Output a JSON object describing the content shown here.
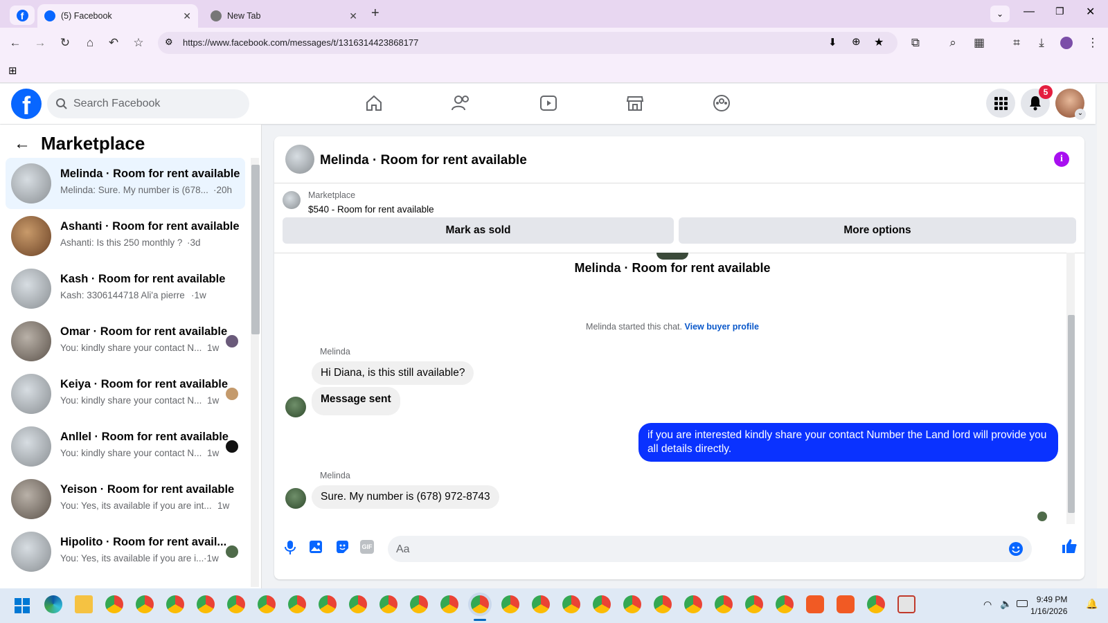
{
  "browser": {
    "tabs": [
      {
        "label": "(5) Facebook",
        "active": true
      },
      {
        "label": "New Tab",
        "active": false
      }
    ],
    "new_tab_symbol": "+",
    "url": "https://www.facebook.com/messages/t/1316314423868177"
  },
  "header": {
    "logo": "f",
    "search_placeholder": "Search Facebook",
    "notification_count": "5"
  },
  "sidebar": {
    "title": "Marketplace",
    "conversations": [
      {
        "name": "Melinda · Room for rent available",
        "preview": "Melinda: Sure. My number is (678...",
        "time": "·20h",
        "selected": true
      },
      {
        "name": "Ashanti · Room for rent available",
        "preview": "Ashanti: Is this 250 monthly ?",
        "time": "·3d",
        "selected": false
      },
      {
        "name": "Kash · Room for rent available",
        "preview": "Kash: 3306144718 Ali'a pierre",
        "time": "·1w",
        "selected": false
      },
      {
        "name": "Omar · Room for rent available",
        "preview": "You: kindly share your contact N...",
        "time": "1w",
        "selected": false
      },
      {
        "name": "Keiya · Room for rent available",
        "preview": "You: kindly share your contact N...",
        "time": "1w",
        "selected": false
      },
      {
        "name": "Anllel · Room for rent available",
        "preview": "You: kindly share your contact N...",
        "time": "1w",
        "selected": false
      },
      {
        "name": "Yeison · Room for rent available",
        "preview": "You: Yes, its available if you are int...",
        "time": "1w",
        "selected": false
      },
      {
        "name": "Hipolito · Room for rent avail...",
        "preview": "You: Yes, its available if you are i...",
        "time": "·1w",
        "selected": false
      }
    ]
  },
  "chat": {
    "title": "Melinda · Room for rent available",
    "listing": {
      "source": "Marketplace",
      "price_title": "$540 - Room for rent available"
    },
    "buttons": {
      "mark_sold": "Mark as sold",
      "more_options": "More options"
    },
    "intro_title": "Melinda · Room for rent available",
    "started_text": "Melinda started this chat.",
    "view_profile": "View buyer profile",
    "messages": [
      {
        "sender": "Melinda",
        "text": "Hi Diana, is this still available?",
        "side": "left"
      },
      {
        "text": "Message sent",
        "side": "left"
      },
      {
        "text": "if you are interested kindly share your contact Number the Land lord will provide you all details directly.",
        "side": "right"
      },
      {
        "sender": "Melinda",
        "text": "Sure. My number is (678) 972-8743",
        "side": "left"
      }
    ],
    "composer_placeholder": "Aa"
  },
  "taskbar": {
    "time": "9:49 PM",
    "date": "1/16/2026"
  },
  "colors": {
    "brand": "#0866ff",
    "outgoing_bubble": "#0a32ff",
    "info_icon": "#a80ff0",
    "badge": "#e41e3f"
  }
}
